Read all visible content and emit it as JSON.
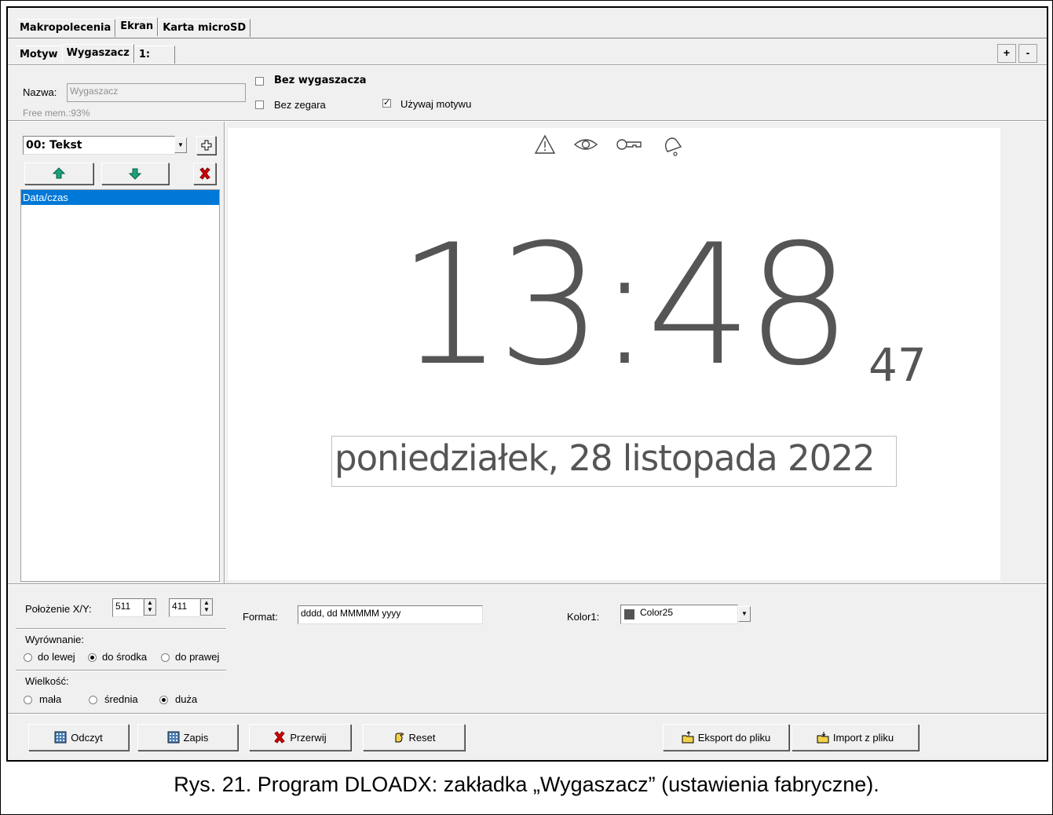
{
  "tabs_top": [
    "Makropolecenia",
    "Ekran",
    "Karta microSD"
  ],
  "tabs_sub": [
    "Motyw",
    "Wygaszacz",
    "1:"
  ],
  "zoom_buttons": {
    "plus": "+",
    "minus": "-"
  },
  "nazwa": {
    "label": "Nazwa:",
    "value": "Wygaszacz"
  },
  "free_mem": "Free mem.:93%",
  "options": {
    "bez_wygaszacza": {
      "label": "Bez wygaszacza",
      "checked": false
    },
    "bez_zegara": {
      "label": "Bez zegara",
      "checked": false
    },
    "uzywaj_motywu": {
      "label": "Używaj motywu",
      "checked": true
    }
  },
  "element_select": {
    "value": "00: Tekst"
  },
  "element_list": [
    "Data/czas"
  ],
  "preview": {
    "time": "13:48",
    "seconds": "47",
    "date": "poniedziałek, 28 listopada 2022",
    "status_icons": [
      "warning-icon",
      "eye-icon",
      "key-icon",
      "bell-icon"
    ]
  },
  "position": {
    "label": "Położenie X/Y:",
    "x": "511",
    "y": "411"
  },
  "format": {
    "label": "Format:",
    "value": "dddd, dd MMMMM yyyy"
  },
  "color": {
    "label": "Kolor1:",
    "value": "Color25",
    "swatch": "#555555"
  },
  "align": {
    "label": "Wyrównanie:",
    "options": [
      "do lewej",
      "do środka",
      "do prawej"
    ],
    "selected": "do środka"
  },
  "size": {
    "label": "Wielkość:",
    "options": [
      "mała",
      "średnia",
      "duża"
    ],
    "selected": "duża"
  },
  "buttons": {
    "read": "Odczyt",
    "write": "Zapis",
    "abort": "Przerwij",
    "reset": "Reset",
    "export": "Eksport do pliku",
    "import": "Import z pliku"
  },
  "caption": "Rys. 21. Program DLOADX: zakładka „Wygaszacz” (ustawienia fabryczne)."
}
